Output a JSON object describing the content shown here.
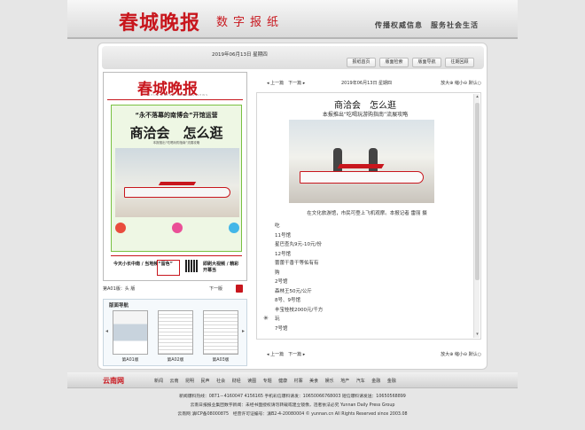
{
  "masthead": {
    "logo": "春城晚报",
    "subtitle": "数字报纸",
    "slogan": "传播权威信息　服务社会生活"
  },
  "topbar": {
    "date": "2019年06月13日 星期四",
    "tabs": [
      "报纸首页",
      "版面检索",
      "版面导航",
      "往期回顾"
    ]
  },
  "paper": {
    "masthead": "春城晚报",
    "masthead_en": "CHUN CHENG EVENING NEWS",
    "ad_headline1": "“永不落幕的南博会”开馆运营",
    "ad_headline2": "商洽会　怎么逛",
    "ad_headline3": "本报推出“吃喝玩购指南”流展攻略",
    "bottom_left": "今天小长中南 / 当地频“留色”",
    "bottom_right": "即刷大视频 / 精彩开幕当"
  },
  "pagebar": {
    "current": "第A01版：头 版",
    "next": "下一版"
  },
  "nav": {
    "header": "版面导航",
    "prev": "◂",
    "next": "▸",
    "thumbs": [
      "第A01版",
      "第A02版",
      "第A03版"
    ]
  },
  "article_toolbar": {
    "prev": "◂ 上一篇　下一篇 ▸",
    "date": "2019年06月13日 星期四",
    "controls": "放大⊕ 缩小⊖ 默认○"
  },
  "article": {
    "title": "商洽会　怎么逛",
    "subtitle": "本报推出“吃喝玩游购指南”流展攻略",
    "caption": "在文化旅游馆，市民可登上飞机观摩。本报记者 雷丽 摄",
    "body": [
      "吃",
      "11号馆",
      "星巴查丸9元-10元/份",
      "12号馆",
      "蕾蕾干香干等佑有有",
      "购",
      "2号馆",
      "森林王50元/公斤",
      "8号、9号馆",
      "丰宝桂枝2000元/千方",
      "玩",
      "7号馆"
    ]
  },
  "article_bottom": {
    "prev": "◂ 上一篇　下一篇 ▸",
    "controls": "放大⊕ 缩小⊖ 默认○"
  },
  "footnav": {
    "logo": "云南网",
    "links": [
      "新闻",
      "云南",
      "昆明",
      "民声",
      "社会",
      "财经",
      "读图",
      "专题",
      "健康",
      "村寨",
      "美食",
      "娱乐",
      "地产",
      "汽车",
      "金融",
      "金融"
    ]
  },
  "footer": {
    "line1": "新闻爆料热线：0871－4160047 4156165 手机彩信爆料请发：10650066768003 短信爆料请发送：10650568899",
    "line2": "云南日报报业集团数字新闻：未经书面授权请勿转载或建立镜像，违者依法必究 Yunnan Daily Press Group",
    "line3": "云南网 滇ICP备08000875　经营许可证编号：滇B2-4-20080004 © yunnan.cn All Rights Reserved since 2003.08"
  }
}
